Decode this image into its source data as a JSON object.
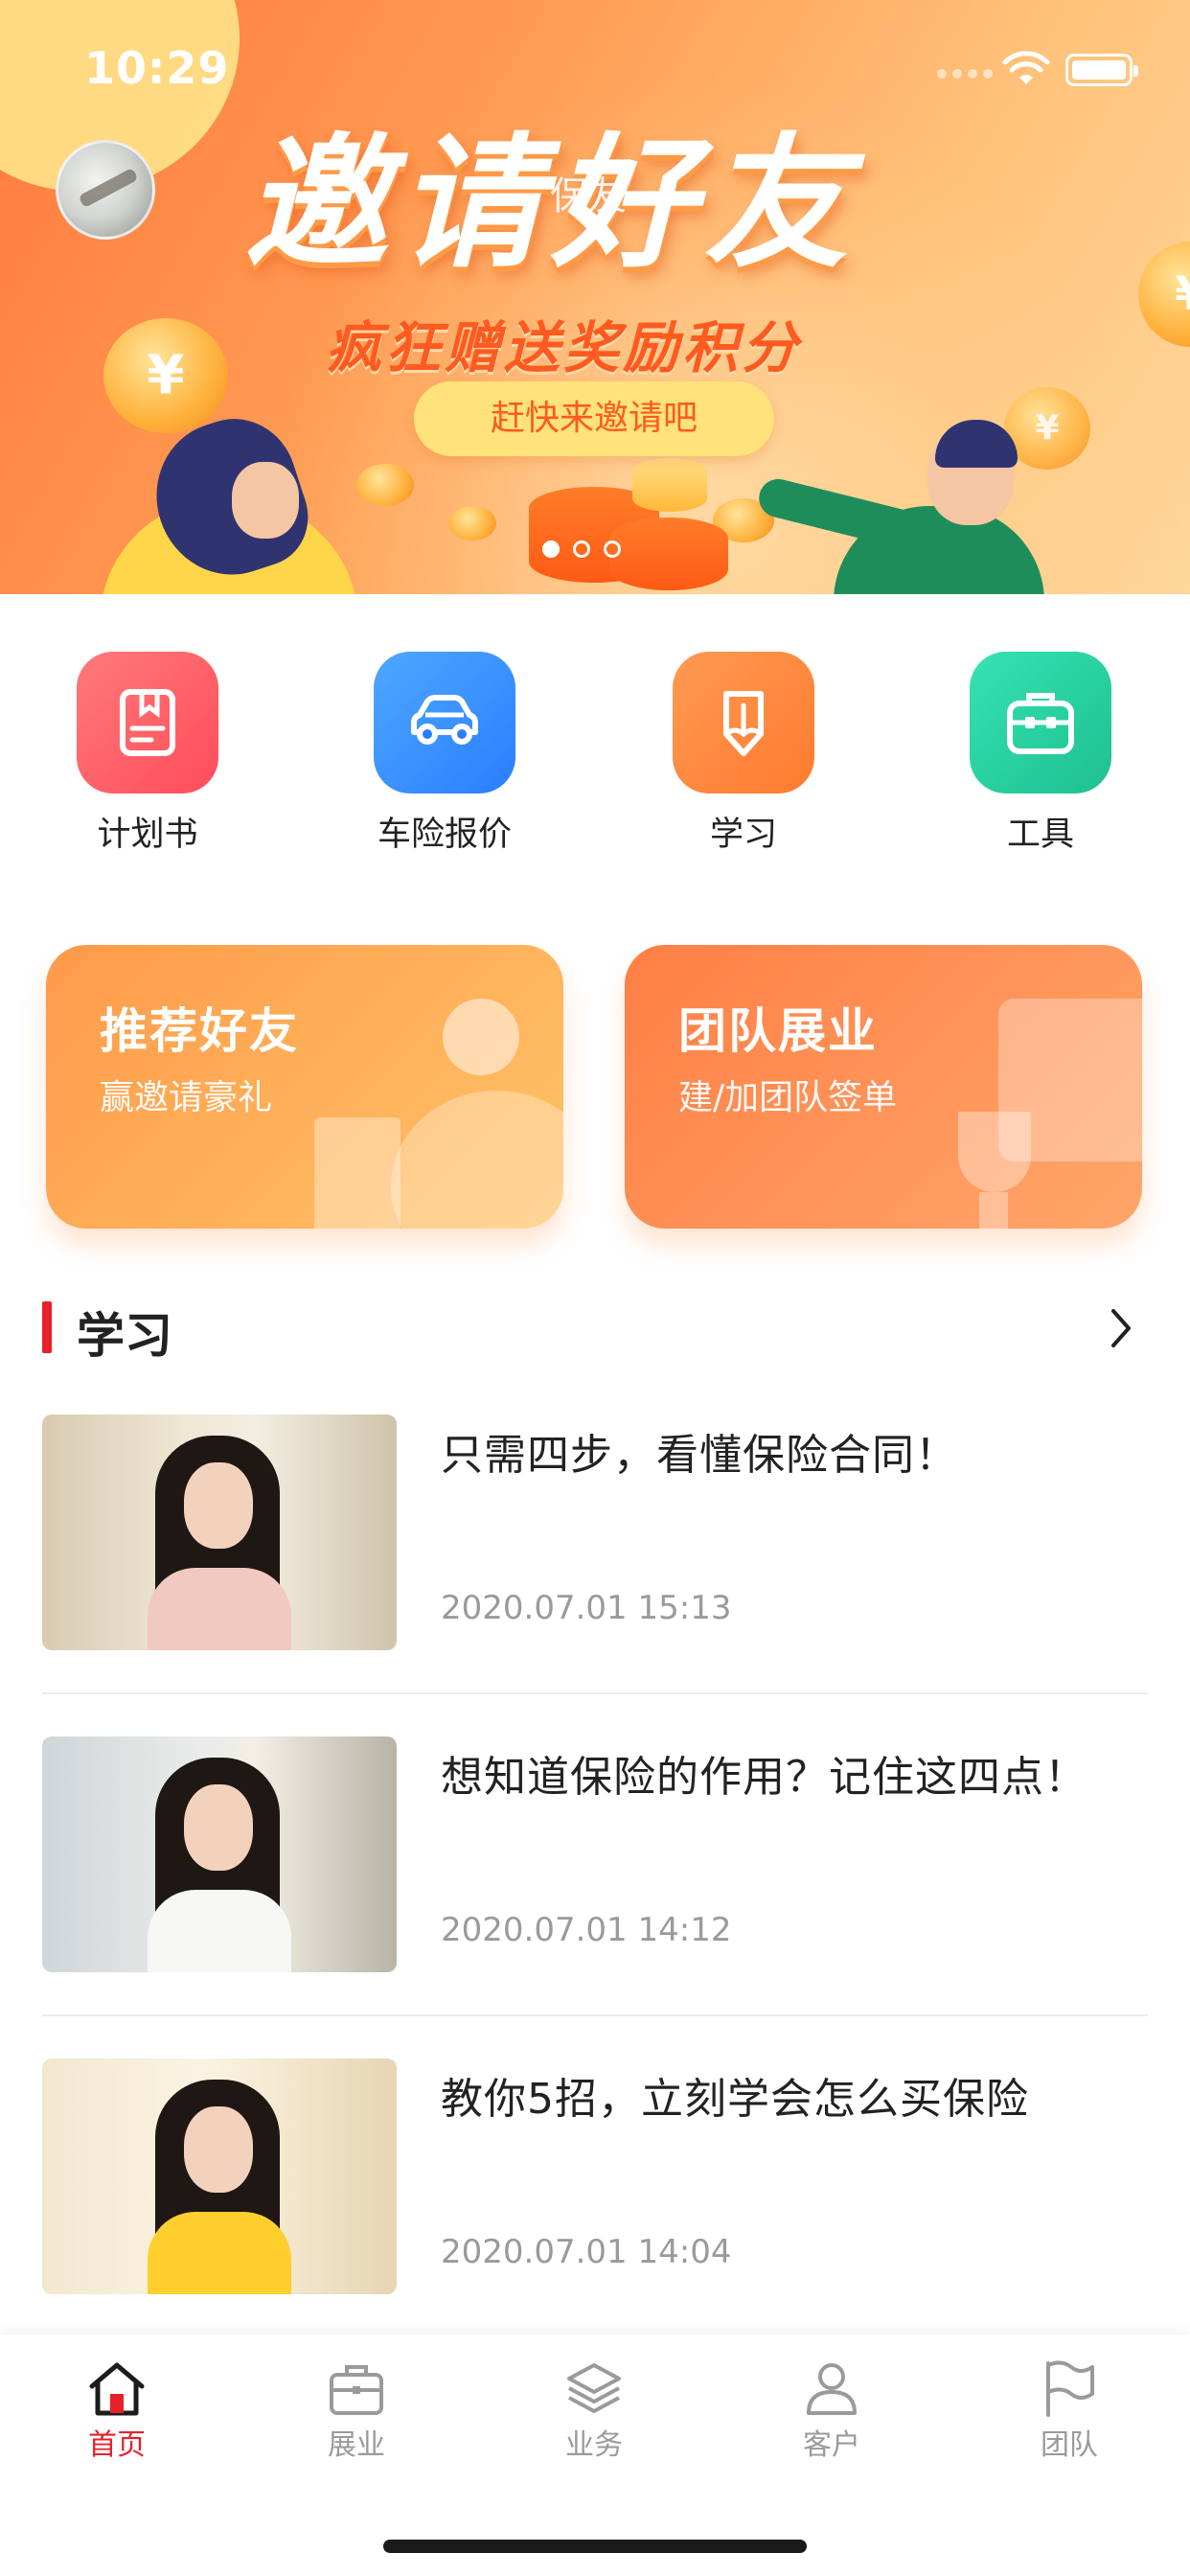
{
  "status_bar": {
    "time": "10:29"
  },
  "banner": {
    "title": "邀请好友",
    "overlay_text": "保友",
    "subtitle": "疯狂赠送奖励积分",
    "pill_text": "赶快来邀请吧",
    "page_count": 3,
    "active_page": 1
  },
  "quick_actions": [
    {
      "label": "计划书",
      "icon": "plan-book-icon",
      "color": "#ff5a63"
    },
    {
      "label": "车险报价",
      "icon": "car-icon",
      "color": "#3a8eff"
    },
    {
      "label": "学习",
      "icon": "pencil-icon",
      "color": "#ff8a3d"
    },
    {
      "label": "工具",
      "icon": "toolbox-icon",
      "color": "#24cf9c"
    }
  ],
  "promo_cards": [
    {
      "title": "推荐好友",
      "subtitle": "赢邀请豪礼"
    },
    {
      "title": "团队展业",
      "subtitle": "建/加团队签单"
    }
  ],
  "learning": {
    "section_title": "学习",
    "articles": [
      {
        "title": "只需四步，看懂保险合同！",
        "date": "2020.07.01 15:13"
      },
      {
        "title": "想知道保险的作用？记住这四点！",
        "date": "2020.07.01 14:12"
      },
      {
        "title": "教你5招，立刻学会怎么买保险",
        "date": "2020.07.01 14:04"
      }
    ]
  },
  "tabbar": {
    "items": [
      {
        "label": "首页",
        "icon": "home-icon",
        "active": true
      },
      {
        "label": "展业",
        "icon": "briefcase-icon",
        "active": false
      },
      {
        "label": "业务",
        "icon": "layers-icon",
        "active": false
      },
      {
        "label": "客户",
        "icon": "person-icon",
        "active": false
      },
      {
        "label": "团队",
        "icon": "flag-icon",
        "active": false
      }
    ],
    "active_color": "#e8202a",
    "inactive_color": "#9a9a9a"
  }
}
